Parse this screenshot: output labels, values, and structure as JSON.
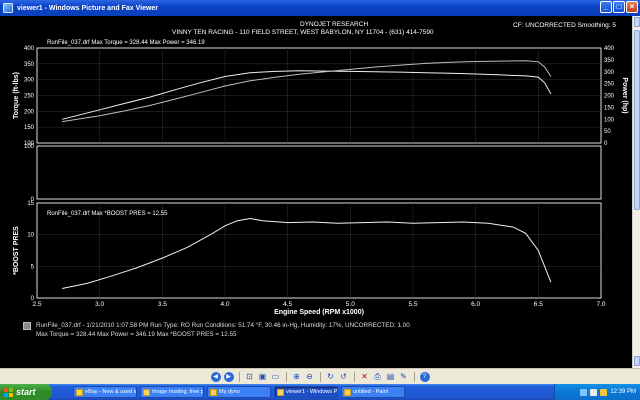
{
  "window": {
    "title": "viewer1 - Windows Picture and Fax Viewer",
    "minimize": "_",
    "maximize": "□",
    "close": "×"
  },
  "dyno": {
    "header_company": "DYNOJET RESEARCH",
    "header_address": "VINNY TEN RACING - 110 FIELD STREET, WEST BABYLON, NY 11704 - (631) 414-7590",
    "header_right": "CF: UNCORRECTED  Smoothing: 5",
    "top_legend": "RunFile_037.drf Max Torque = 328.44  Max Power = 346.19",
    "bottom_legend": "RunFile_037.drf Max *BOOST PRES = 12.55",
    "footer_line1": "RunFile_037.drf - 1/21/2010 1:07:58 PM  Run Type: RO  Run Conditions: 51.74 °F, 30.46 in-Hg,  Humidity: 17%, UNCORRECTED: 1.00",
    "footer_line2": "Max Torque = 328.44  Max Power = 346.19  Max *BOOST PRES = 12.55"
  },
  "chart_data": [
    {
      "type": "line",
      "panel": "torque-power",
      "ylabel": "Torque (ft-lbs)",
      "y2label": "Power (hp)",
      "xlim": [
        2.5,
        7.0
      ],
      "ylim": [
        100,
        400
      ],
      "y2lim": [
        0,
        400
      ],
      "yticks": [
        100,
        150,
        200,
        250,
        300,
        350,
        400
      ],
      "y2ticks": [
        0,
        50,
        100,
        150,
        200,
        250,
        300,
        350,
        400
      ],
      "grid": true,
      "series": [
        {
          "name": "Torque",
          "x": [
            2.7,
            3.0,
            3.2,
            3.4,
            3.6,
            3.8,
            4.0,
            4.2,
            4.4,
            4.6,
            4.8,
            5.0,
            5.2,
            5.4,
            5.6,
            5.8,
            6.0,
            6.2,
            6.4,
            6.5,
            6.55,
            6.6
          ],
          "values": [
            175,
            205,
            225,
            245,
            268,
            290,
            310,
            322,
            326,
            328,
            327,
            326,
            325,
            324,
            322,
            320,
            318,
            315,
            312,
            308,
            290,
            255
          ]
        },
        {
          "name": "Power",
          "x": [
            2.7,
            3.0,
            3.2,
            3.4,
            3.6,
            3.8,
            4.0,
            4.2,
            4.4,
            4.6,
            4.8,
            5.0,
            5.2,
            5.4,
            5.6,
            5.8,
            6.0,
            6.2,
            6.4,
            6.5,
            6.55,
            6.6
          ],
          "values": [
            90,
            115,
            135,
            158,
            185,
            212,
            240,
            262,
            277,
            290,
            300,
            310,
            320,
            328,
            335,
            340,
            343,
            345,
            346,
            342,
            320,
            280
          ]
        }
      ]
    },
    {
      "type": "line",
      "panel": "middle",
      "ylim": [
        0,
        100
      ],
      "yticks": [
        0,
        100
      ],
      "series": []
    },
    {
      "type": "line",
      "panel": "boost",
      "ylabel": "*BOOST PRES",
      "xlabel": "Engine Speed (RPM x1000)",
      "xlim": [
        2.5,
        7.0
      ],
      "xticks": [
        2.5,
        3.0,
        3.5,
        4.0,
        4.5,
        5.0,
        5.5,
        6.0,
        6.5,
        7.0
      ],
      "ylim": [
        0,
        15
      ],
      "yticks": [
        0,
        5,
        10,
        15
      ],
      "grid": true,
      "series": [
        {
          "name": "*BOOST PRES",
          "x": [
            2.7,
            2.9,
            3.1,
            3.3,
            3.5,
            3.7,
            3.9,
            4.0,
            4.1,
            4.2,
            4.3,
            4.5,
            4.7,
            4.9,
            5.1,
            5.3,
            5.5,
            5.7,
            5.9,
            6.1,
            6.3,
            6.4,
            6.5,
            6.55,
            6.6
          ],
          "values": [
            1.5,
            2.3,
            3.5,
            4.8,
            6.3,
            8.0,
            10.2,
            11.4,
            12.2,
            12.55,
            12.2,
            11.9,
            12.0,
            11.8,
            11.9,
            12.0,
            11.8,
            11.9,
            12.0,
            11.8,
            11.2,
            10.2,
            7.5,
            5.0,
            2.5
          ]
        }
      ]
    }
  ],
  "toolbar": {
    "icons": [
      "previous-icon",
      "next-icon",
      "best-fit-icon",
      "actual-size-icon",
      "slideshow-icon",
      "zoom-in-icon",
      "zoom-out-icon",
      "rotate-cw-icon",
      "rotate-ccw-icon",
      "delete-icon",
      "print-icon",
      "save-icon",
      "edit-icon",
      "help-icon"
    ]
  },
  "taskbar": {
    "start_label": "start",
    "items": [
      {
        "label": "eBay - New & used el...",
        "active": false
      },
      {
        "label": "Image hosting, free p...",
        "active": false
      },
      {
        "label": "My dyno",
        "active": false
      },
      {
        "label": "viewer1 - Windows Pi...",
        "active": true
      },
      {
        "label": "untitled - Paint",
        "active": false
      }
    ],
    "clock": "12:39 PM"
  }
}
